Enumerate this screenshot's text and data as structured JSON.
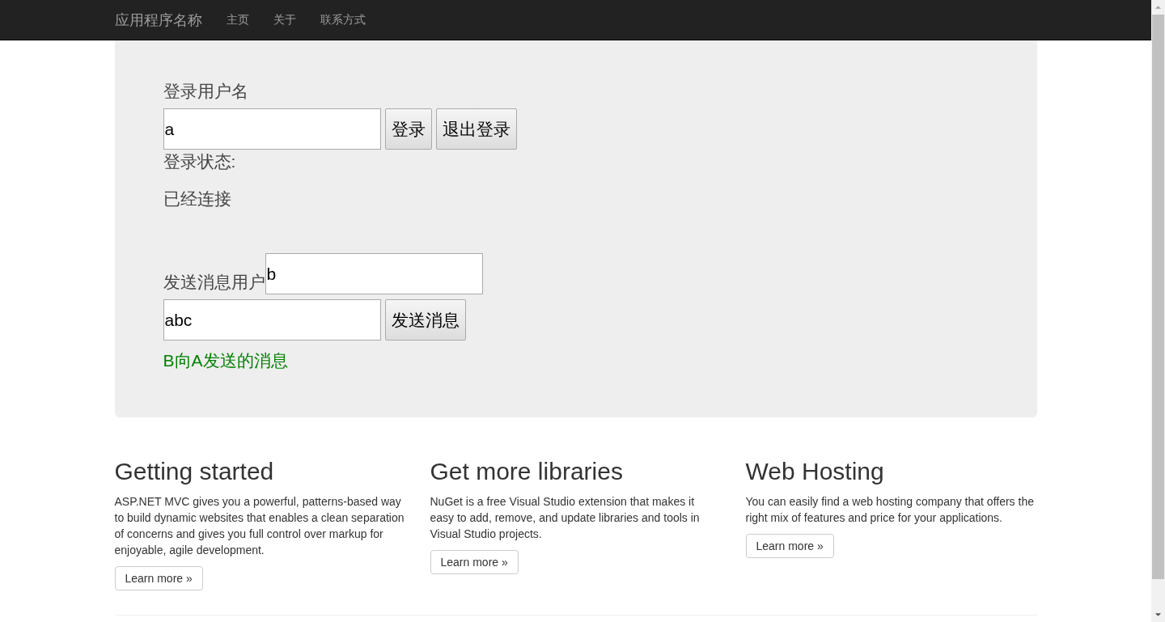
{
  "navbar": {
    "brand": "应用程序名称",
    "links": [
      {
        "label": "主页"
      },
      {
        "label": "关于"
      },
      {
        "label": "联系方式"
      }
    ]
  },
  "login": {
    "label": "登录用户名",
    "username": "a",
    "buttons": [
      "登录",
      "退出登录"
    ],
    "status_label": "登录状态:",
    "status": "已经连接"
  },
  "send": {
    "label": "发送消息用户",
    "recipient": "b",
    "message": "abc",
    "button": "发送消息",
    "received": "B向A发送的消息"
  },
  "columns": [
    {
      "title": "Getting started",
      "text": "ASP.NET MVC gives you a powerful, patterns-based way to build dynamic websites that enables a clean separation of concerns and gives you full control over markup for enjoyable, agile development.",
      "button": "Learn more »"
    },
    {
      "title": "Get more libraries",
      "text": "NuGet is a free Visual Studio extension that makes it easy to add, remove, and update libraries and tools in Visual Studio projects.",
      "button": "Learn more »"
    },
    {
      "title": "Web Hosting",
      "text": "You can easily find a web hosting company that offers the right mix of features and price for your applications.",
      "button": "Learn more »"
    }
  ]
}
